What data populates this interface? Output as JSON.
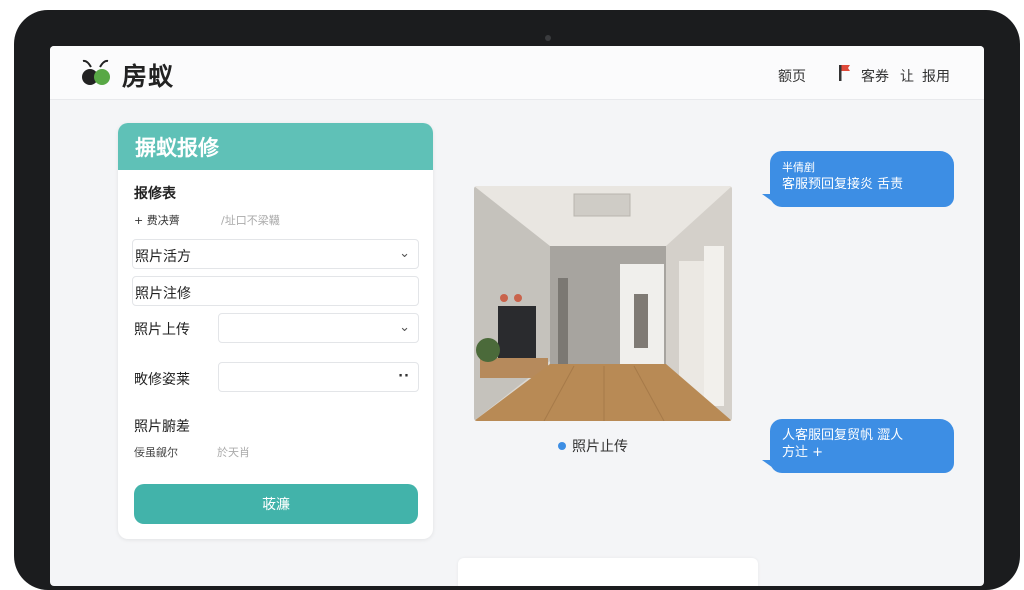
{
  "app": {
    "name": "房蚁"
  },
  "nav": {
    "home": "额页",
    "service": "客券",
    "profile": "让",
    "report": "报用"
  },
  "form": {
    "title": "摒蚁报修",
    "section1": "报修表",
    "hint_left": "+ 费决薺",
    "hint_right": "/址口不梁韈",
    "field_area": "照片活方",
    "field_repair": "照片注修",
    "label_upload": "照片上传",
    "label_plan": "畋修姿莱",
    "section2": "照片腑差",
    "hint2_left": "佞虽觎尔",
    "hint2_right": "於天肖",
    "submit_label": "荍濂"
  },
  "photo": {
    "caption": "照片止传"
  },
  "chat": {
    "bubble1_line1": "半倩剷",
    "bubble1_line2": "客服预回复接炎 舌责",
    "bubble2_line1": "人客服回复贸帆 澀人",
    "bubble2_line2": "方辻 +"
  },
  "colors": {
    "teal_header": "#5fc1b7",
    "teal_button": "#42b3aa",
    "chat_blue": "#3d8ee4"
  },
  "icons": {
    "logo": "ant-logo-icon",
    "flag": "flag-icon",
    "dropdown": "chevron-down-icon",
    "more": "more-dots-icon"
  }
}
